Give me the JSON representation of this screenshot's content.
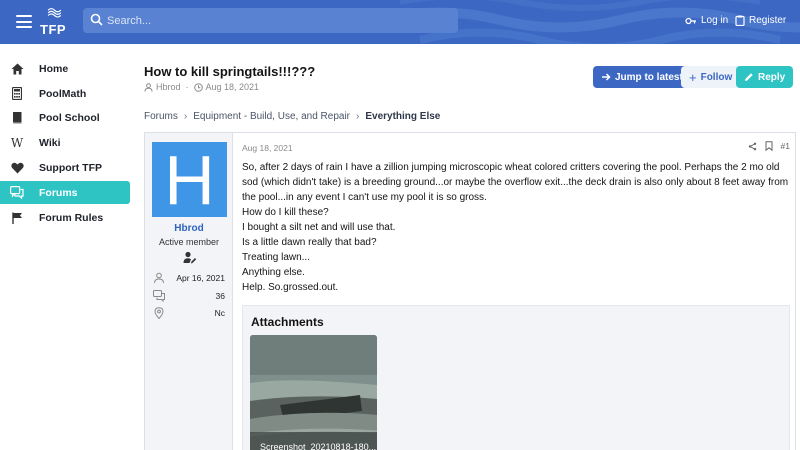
{
  "header": {
    "logo_text": "TFP",
    "search_placeholder": "Search...",
    "login_label": "Log in",
    "register_label": "Register"
  },
  "sidebar": {
    "items": [
      {
        "label": "Home",
        "icon": "home-icon"
      },
      {
        "label": "PoolMath",
        "icon": "calculator-icon"
      },
      {
        "label": "Pool School",
        "icon": "book-icon"
      },
      {
        "label": "Wiki",
        "icon": "wikipedia-icon"
      },
      {
        "label": "Support TFP",
        "icon": "heart-icon"
      },
      {
        "label": "Forums",
        "icon": "comments-icon",
        "active": true
      },
      {
        "label": "Forum Rules",
        "icon": "flag-icon"
      }
    ]
  },
  "thread": {
    "title": "How to kill springtails!!!???",
    "author": "Hbrod",
    "date": "Aug 18, 2021"
  },
  "buttons": {
    "jump": "Jump to latest",
    "follow": "Follow",
    "reply": "Reply"
  },
  "breadcrumb": [
    "Forums",
    "Equipment - Build, Use, and Repair",
    "Everything Else"
  ],
  "post": {
    "user": {
      "avatar_letter": "H",
      "name": "Hbrod",
      "title": "Active member",
      "joined": "Apr 16, 2021",
      "messages": "36",
      "location": "Nc"
    },
    "date": "Aug 18, 2021",
    "number": "#1",
    "lines": [
      "So, after 2 days of rain I have a zillion jumping microscopic wheat colored critters covering the pool. Perhaps the 2 mo old sod (which didn't take) is a breeding ground...or maybe the overflow exit...the deck drain is also only about 8 feet away from the pool...in any event I can't use my pool it is so gross.",
      "How do I kill these?",
      "I bought a silt net and will use that.",
      "Is a little dawn really that bad?",
      "Treating lawn...",
      "Anything else.",
      "Help. So.grossed.out."
    ],
    "attachments_title": "Attachments",
    "attachment_caption": "Screenshot_20210818-180..."
  },
  "colors": {
    "header": "#3c68c4",
    "accent_teal": "#2ec4c4",
    "avatar": "#3f95e6"
  }
}
